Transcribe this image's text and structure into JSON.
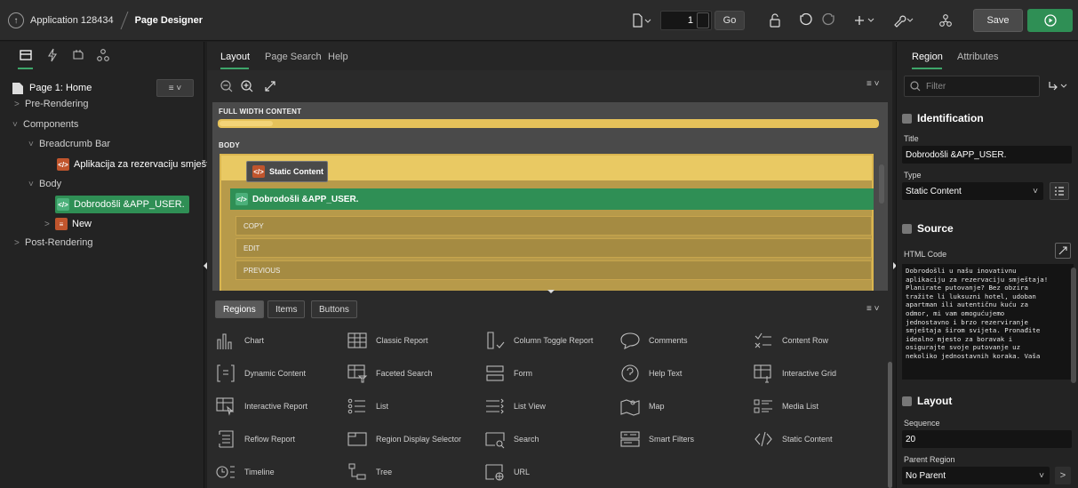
{
  "topbar": {
    "app_name": "Application 128434",
    "page_designer": "Page Designer",
    "page_number": "1",
    "go_label": "Go",
    "save_label": "Save"
  },
  "left_panel": {
    "page_title": "Page 1: Home",
    "tree": {
      "pre_rendering": "Pre-Rendering",
      "components": "Components",
      "breadcrumb_bar": "Breadcrumb Bar",
      "breadcrumb_region": "Aplikacija za rezervaciju smještaja",
      "body": "Body",
      "body_region_selected": "Dobrodošli &APP_USER.",
      "new_region": "New",
      "post_rendering": "Post-Rendering"
    }
  },
  "center": {
    "tabs": [
      "Layout",
      "Page Search",
      "Help"
    ],
    "canvas": {
      "full_width_label": "FULL WIDTH CONTENT",
      "body_label": "BODY",
      "static_content_chip": "Static Content",
      "selected_region": "Dobrodošli &APP_USER.",
      "buttons": [
        "COPY",
        "EDIT",
        "PREVIOUS"
      ]
    },
    "gallery_tabs": [
      "Regions",
      "Items",
      "Buttons"
    ],
    "gallery_items": [
      [
        "Chart",
        "Classic Report",
        "Column Toggle Report",
        "Comments",
        "Content Row"
      ],
      [
        "Dynamic Content",
        "Faceted Search",
        "Form",
        "Help Text",
        "Interactive Grid"
      ],
      [
        "Interactive Report",
        "List",
        "List View",
        "Map",
        "Media List"
      ],
      [
        "Reflow Report",
        "Region Display Selector",
        "Search",
        "Smart Filters",
        "Static Content"
      ],
      [
        "Timeline",
        "Tree",
        "URL"
      ]
    ]
  },
  "right_panel": {
    "tabs": [
      "Region",
      "Attributes"
    ],
    "filter_placeholder": "Filter",
    "identification": {
      "header": "Identification",
      "title_label": "Title",
      "title_value": "Dobrodošli &APP_USER.",
      "type_label": "Type",
      "type_value": "Static Content"
    },
    "source": {
      "header": "Source",
      "html_label": "HTML Code",
      "html_value": "Dobrodošli u našu inovativnu\naplikaciju za rezervaciju smještaja!\nPlanirate putovanje? Bez obzira\ntražite li luksuzni hotel, udoban\napartman ili autentičnu kuću za\nodmor, mi vam omogućujemo\njednostavno i brzo rezerviranje\nsmještaja širom svijeta. Pronađite\nidealno mjesto za boravak i\nosigurajte svoje putovanje uz\nnekoliko jednostavnih koraka. Vaša"
    },
    "layout": {
      "header": "Layout",
      "sequence_label": "Sequence",
      "sequence_value": "20",
      "parent_label": "Parent Region",
      "parent_value": "No Parent"
    }
  },
  "colors": {
    "accent_green": "#2f8f55",
    "region_yellow": "#e2bc55",
    "body_gold": "#b79a4a"
  }
}
